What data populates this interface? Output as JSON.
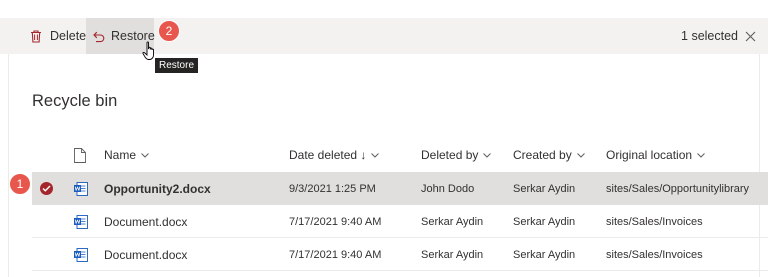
{
  "toolbar": {
    "delete_label": "Delete",
    "restore_label": "Restore",
    "selected_text": "1 selected"
  },
  "annotations": {
    "step1": "1",
    "step2": "2"
  },
  "tooltip": "Restore",
  "page": {
    "title": "Recycle bin"
  },
  "columns": {
    "name": "Name",
    "date_deleted": "Date deleted ↓",
    "deleted_by": "Deleted by",
    "created_by": "Created by",
    "original_location": "Original location"
  },
  "rows": [
    {
      "name": "Opportunity2.docx",
      "date_deleted": "9/3/2021 1:25 PM",
      "deleted_by": "John Dodo",
      "created_by": "Serkar Aydin",
      "original_location": "sites/Sales/Opportunitylibrary",
      "selected": true
    },
    {
      "name": "Document.docx",
      "date_deleted": "7/17/2021 9:40 AM",
      "deleted_by": "Serkar Aydin",
      "created_by": "Serkar Aydin",
      "original_location": "sites/Sales/Invoices",
      "selected": false
    },
    {
      "name": "Document.docx",
      "date_deleted": "7/17/2021 9:40 AM",
      "deleted_by": "Serkar Aydin",
      "created_by": "Serkar Aydin",
      "original_location": "sites/Sales/Invoices",
      "selected": false
    }
  ],
  "icons": {
    "delete": "trash-icon",
    "restore": "undo-arrow-icon",
    "close": "close-icon",
    "file_type": "file-type-icon",
    "word_doc": "word-document-icon",
    "selected": "check-circle-icon"
  },
  "colors": {
    "annotation_badge": "#e8574d",
    "selection_check": "#a4262c",
    "word_blue": "#185abd",
    "command_bar": "#f3f2f1",
    "selected_row": "#e1dfdd"
  }
}
